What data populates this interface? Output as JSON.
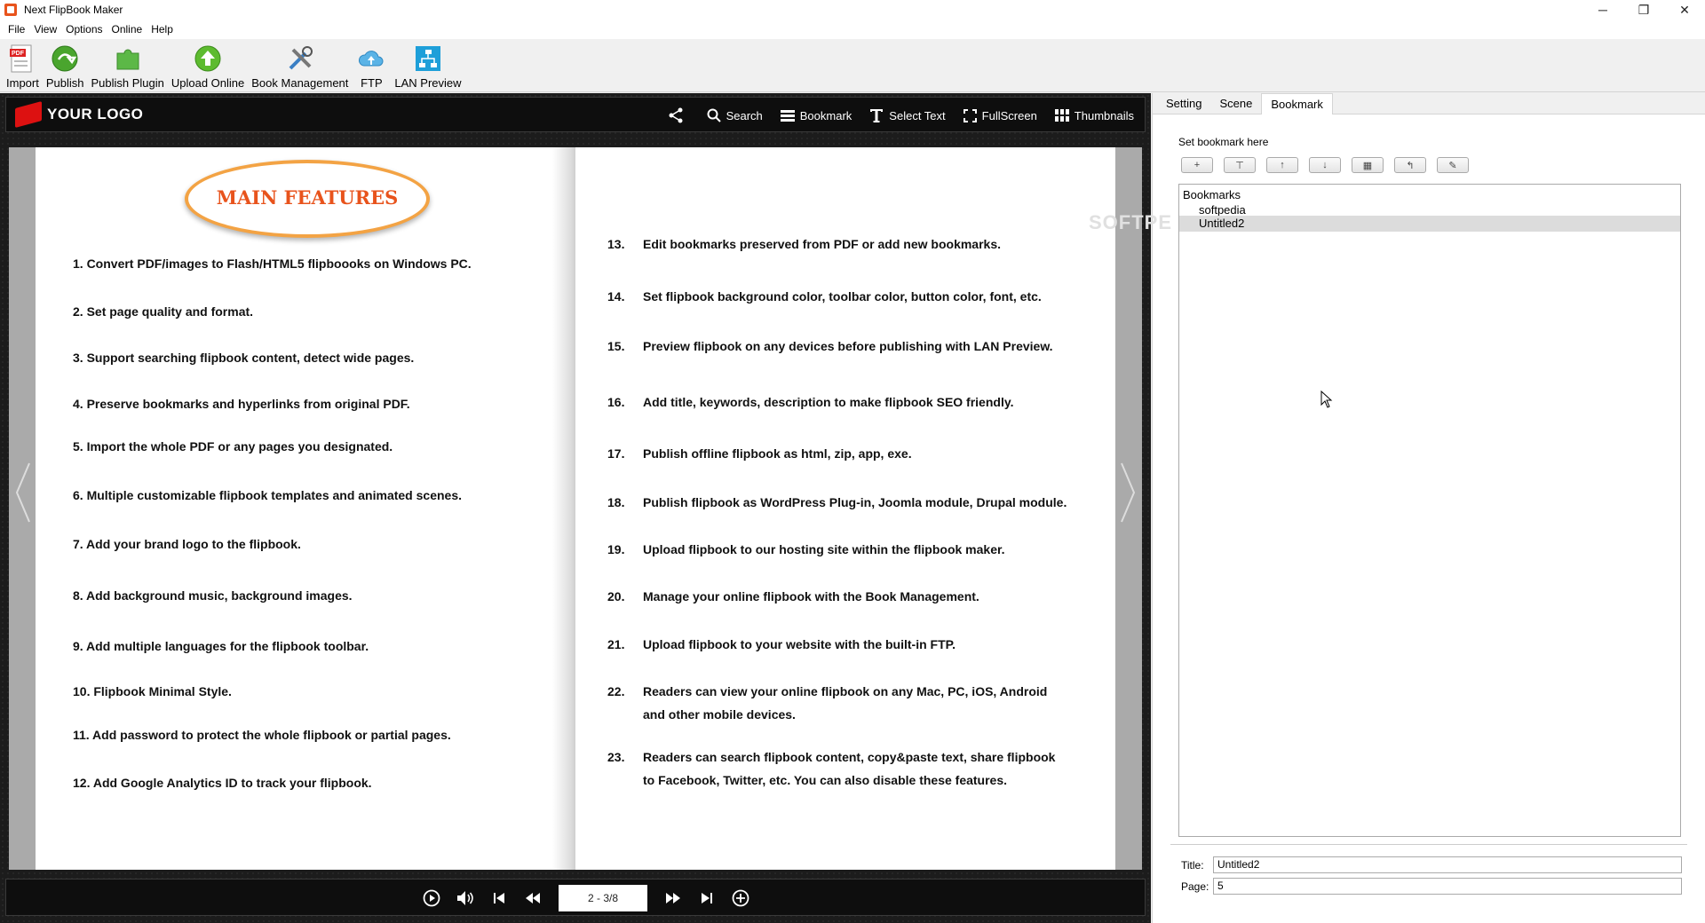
{
  "window": {
    "title": "Next FlipBook Maker",
    "minimize": "─",
    "restore": "❐",
    "close": "✕"
  },
  "menu": [
    "File",
    "View",
    "Options",
    "Online",
    "Help"
  ],
  "toolbar": [
    {
      "label": "Import",
      "icon": "pdf-import-icon"
    },
    {
      "label": "Publish",
      "icon": "publish-icon"
    },
    {
      "label": "Publish Plugin",
      "icon": "plugin-icon"
    },
    {
      "label": "Upload Online",
      "icon": "upload-icon"
    },
    {
      "label": "Book Management",
      "icon": "tools-icon"
    },
    {
      "label": "FTP",
      "icon": "cloud-icon"
    },
    {
      "label": "LAN Preview",
      "icon": "network-icon"
    }
  ],
  "viewer": {
    "logo": "YOUR LOGO",
    "tools": [
      "Search",
      "Bookmark",
      "Select Text",
      "FullScreen",
      "Thumbnails"
    ],
    "page_indicator": "2 - 3/8"
  },
  "book": {
    "badge": "MAIN FEATURES",
    "left_items": [
      "1. Convert PDF/images to Flash/HTML5 flipboooks on Windows PC.",
      "2. Set page quality and format.",
      "3. Support searching flipbook content, detect wide pages.",
      "4. Preserve bookmarks and hyperlinks from original PDF.",
      "5. Import the whole PDF or any pages you designated.",
      "6. Multiple customizable flipbook templates and animated scenes.",
      "7. Add your brand logo to the flipbook.",
      "8. Add background music, background images.",
      "9. Add multiple languages for the flipbook toolbar.",
      "10. Flipbook Minimal Style.",
      "11. Add password to protect the whole flipbook or partial pages.",
      "12. Add Google Analytics ID to track your flipbook."
    ],
    "right_items": [
      {
        "num": "13.",
        "text": "Edit bookmarks preserved from PDF or add new bookmarks."
      },
      {
        "num": "14.",
        "text": "Set flipbook background color, toolbar color, button color, font, etc."
      },
      {
        "num": "15.",
        "text": "Preview flipbook on any devices before publishing with LAN Preview."
      },
      {
        "num": "16.",
        "text": "Add  title, keywords, description to make flipbook SEO friendly."
      },
      {
        "num": "17.",
        "text": "Publish offline flipbook as html, zip, app, exe."
      },
      {
        "num": "18.",
        "text": "Publish flipbook as WordPress Plug-in, Joomla module, Drupal module."
      },
      {
        "num": "19.",
        "text": "Upload flipbook to our hosting site within the flipbook maker."
      },
      {
        "num": "20.",
        "text": "Manage your online flipbook with the Book Management."
      },
      {
        "num": "21.",
        "text": "Upload flipbook to your website with the built-in FTP."
      },
      {
        "num": "22.",
        "text": "Readers can view your online flipbook on any Mac, PC, iOS, Android",
        "text2": "and other mobile devices."
      },
      {
        "num": "23.",
        "text": "Readers can search flipbook content, copy&paste text, share flipbook",
        "text2": "to Facebook, Twitter, etc. You can also disable these features."
      }
    ]
  },
  "panel": {
    "tabs": [
      "Setting",
      "Scene",
      "Bookmark"
    ],
    "active_tab": "Bookmark",
    "set_bookmark_label": "Set bookmark here",
    "tool_buttons": [
      "+",
      "⊤",
      "↑",
      "↓",
      "▦",
      "↰",
      "✎"
    ],
    "tree_root": "Bookmarks",
    "bookmarks": [
      "softpedia",
      "Untitled2"
    ],
    "selected": "Untitled2",
    "title_label": "Title:",
    "title_value": "Untitled2",
    "page_label": "Page:",
    "page_value": "5",
    "watermark": "SOFTPE"
  }
}
